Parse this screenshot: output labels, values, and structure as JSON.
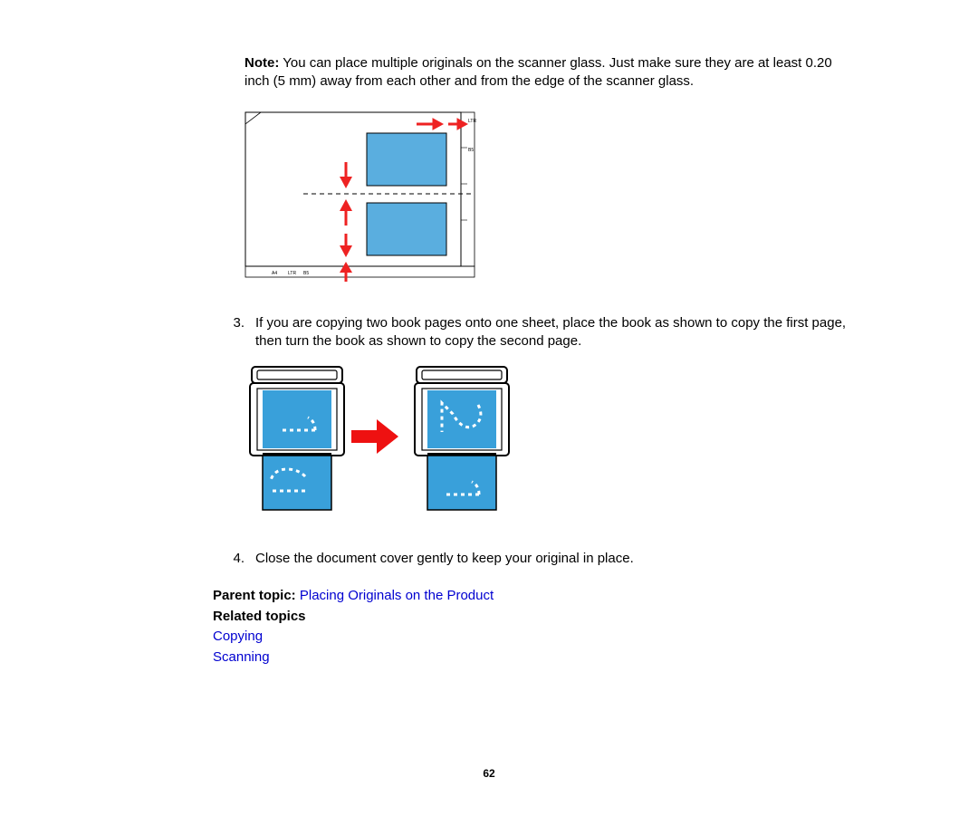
{
  "note": {
    "label": "Note:",
    "text": " You can place multiple originals on the scanner glass. Just make sure they are at least 0.20 inch (5 mm) away from each other and from the edge of the scanner glass."
  },
  "steps": {
    "s3": {
      "num": "3.",
      "text": "If you are copying two book pages onto one sheet, place the book as shown to copy the first page, then turn the book as shown to copy the second page."
    },
    "s4": {
      "num": "4.",
      "text": "Close the document cover gently to keep your original in place."
    }
  },
  "parentTopic": {
    "label": "Parent topic:",
    "link": "Placing Originals on the Product"
  },
  "relatedTopics": {
    "label": "Related topics",
    "links": {
      "copying": "Copying",
      "scanning": "Scanning"
    }
  },
  "pageNumber": "62"
}
